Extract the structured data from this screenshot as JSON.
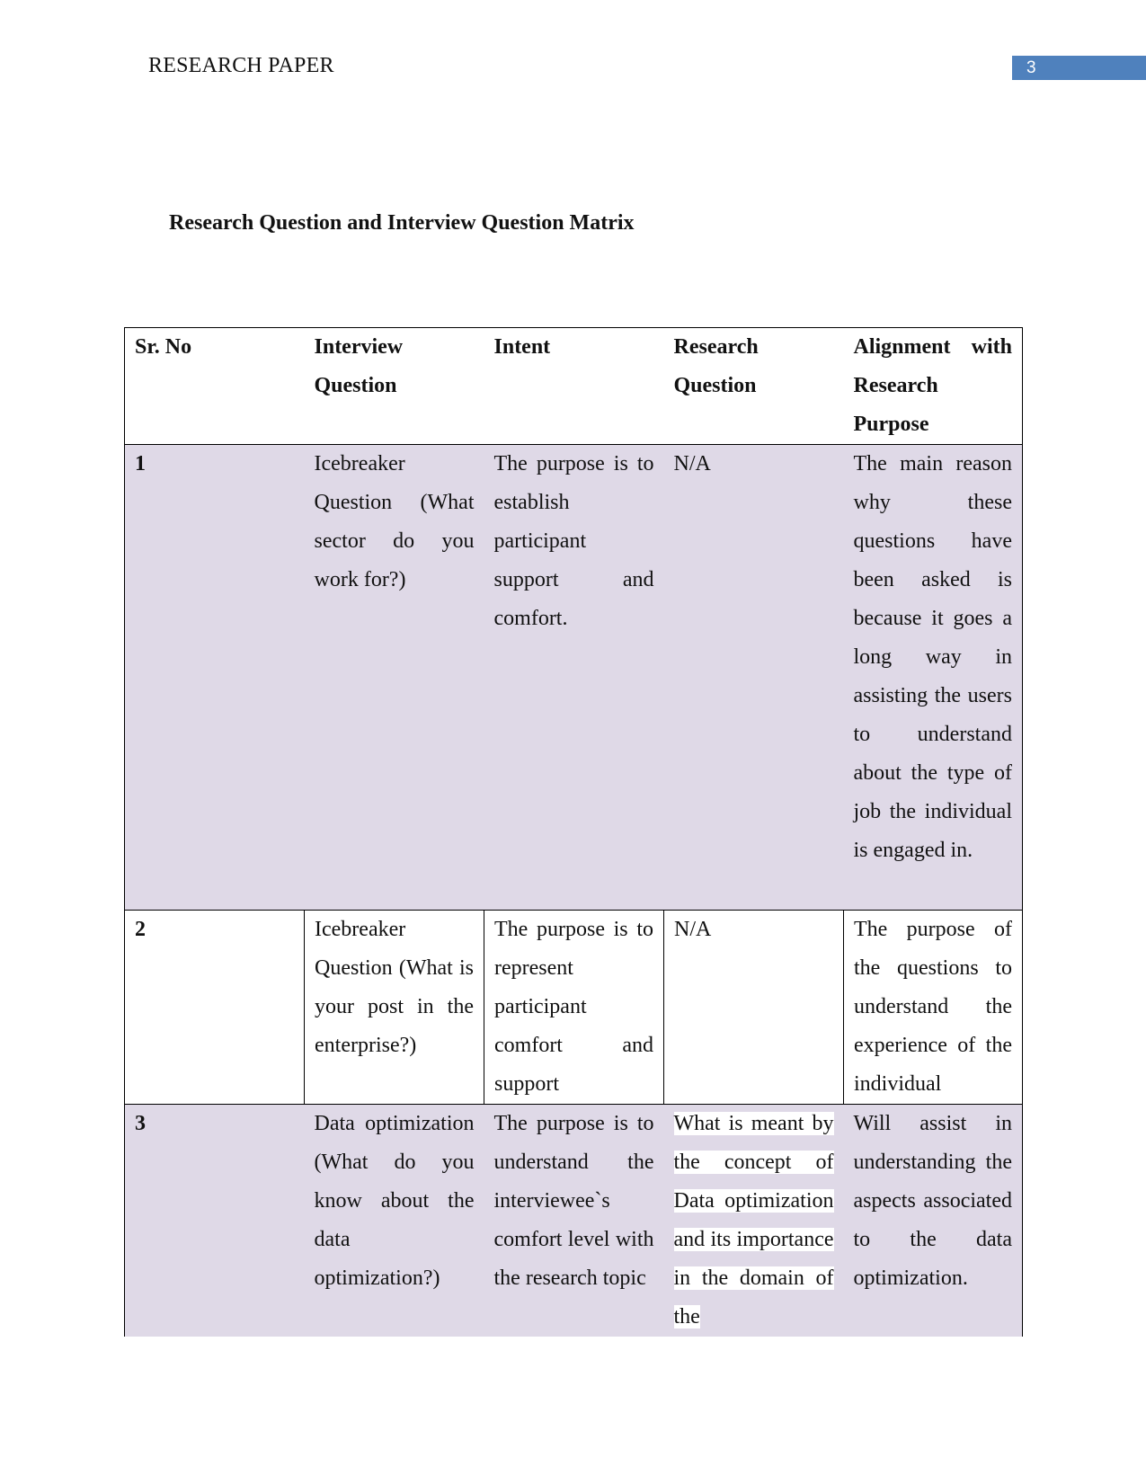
{
  "header": {
    "running_head": "RESEARCH PAPER",
    "page_number": "3",
    "accent_color": "#4f81bd"
  },
  "title": "Research Question and Interview Question Matrix",
  "table": {
    "columns": [
      "Sr. No",
      "Interview Question",
      "Intent",
      "Research Question",
      "Alignment with Research Purpose"
    ],
    "shade_color": "#dfd9e7",
    "rows": [
      {
        "sr": "1",
        "interview_question": "Icebreaker Question (What sector do you work for?)",
        "intent": "The purpose is to establish participant support and comfort.",
        "research_question": "N/A",
        "alignment": "The main reason why these questions have been asked is because it goes a long way in assisting the users to understand about the type of job the individual is engaged in."
      },
      {
        "sr": "2",
        "interview_question": "Icebreaker Question (What is your post in the enterprise?)",
        "intent": "The purpose is to represent participant comfort and support",
        "research_question": "N/A",
        "alignment": "The purpose of the questions to understand the experience of the individual"
      },
      {
        "sr": "3",
        "interview_question": "Data optimization (What do you know about the data optimization?)",
        "intent": "The purpose is to understand the interviewee`s comfort level with the research topic",
        "research_question": "What is meant by the concept of Data optimization and its importance in the domain of the",
        "alignment": "Will assist in understanding the aspects associated to the data optimization."
      }
    ]
  }
}
